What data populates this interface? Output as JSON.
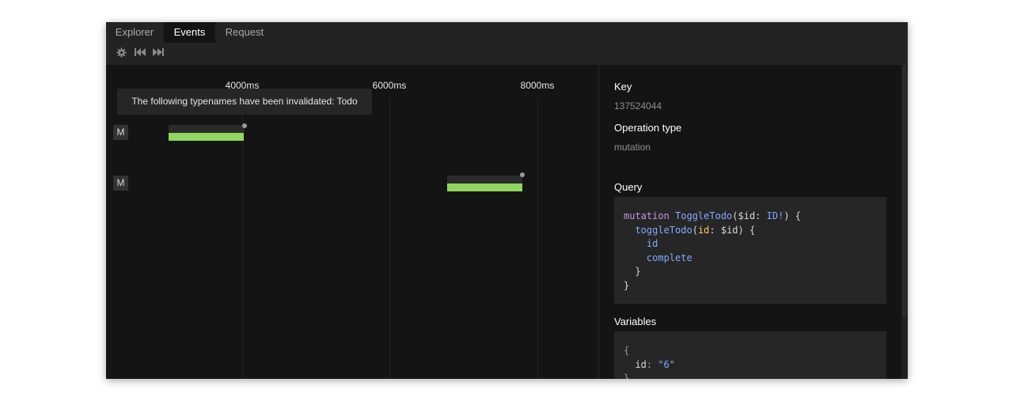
{
  "tabs": [
    {
      "label": "Explorer",
      "active": false
    },
    {
      "label": "Events",
      "active": true
    },
    {
      "label": "Request",
      "active": false
    }
  ],
  "toolbar": {
    "icons": [
      "gear-icon",
      "skip-back-icon",
      "skip-forward-icon"
    ]
  },
  "timeline": {
    "ticks": [
      "4000ms",
      "6000ms",
      "8000ms"
    ],
    "tooltip": "The following typenames have been invalidated: Todo",
    "events": [
      {
        "badge": "M"
      },
      {
        "badge": "M"
      }
    ]
  },
  "detail": {
    "key_heading": "Key",
    "key_value": "137524044",
    "op_heading": "Operation type",
    "op_value": "mutation",
    "query_heading": "Query",
    "query": {
      "l1_kw": "mutation",
      "l1_name": "ToggleTodo",
      "l1_rest_a": "($id: ",
      "l1_type": "ID!",
      "l1_rest_b": ") {",
      "l2_field": "toggleTodo",
      "l2_paren": "(",
      "l2_arg": "id",
      "l2_rest": ": $id) {",
      "l3": "id",
      "l4": "complete",
      "l5": "}",
      "l6": "}"
    },
    "variables_heading": "Variables",
    "variables": {
      "open": "{",
      "key": "id",
      "colon": ": ",
      "value": "\"6\"",
      "close": "}"
    }
  },
  "colors": {
    "accent_green": "#8fd75e",
    "background": "#141414"
  }
}
